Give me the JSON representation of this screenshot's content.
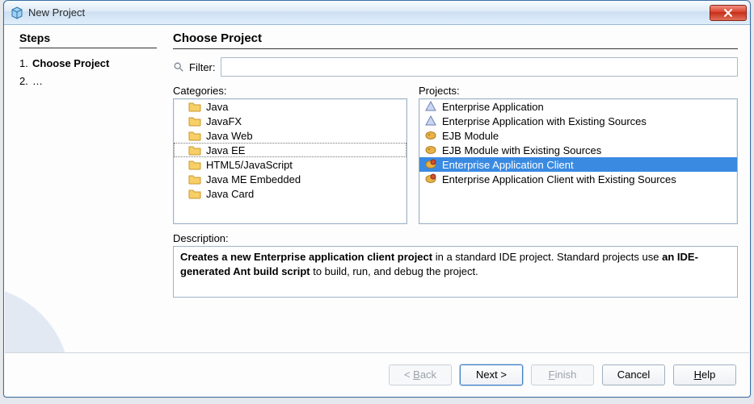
{
  "window": {
    "title": "New Project"
  },
  "steps": {
    "heading": "Steps",
    "items": [
      {
        "num": "1.",
        "label": "Choose Project",
        "current": true
      },
      {
        "num": "2.",
        "label": "…",
        "current": false
      }
    ]
  },
  "main": {
    "heading": "Choose Project",
    "filter_label": "Filter:",
    "filter_value": "",
    "categories_label": "Categories:",
    "projects_label": "Projects:",
    "description_label": "Description:"
  },
  "categories": [
    {
      "label": "Java",
      "icon": "folder",
      "selected": false
    },
    {
      "label": "JavaFX",
      "icon": "folder",
      "selected": false
    },
    {
      "label": "Java Web",
      "icon": "folder",
      "selected": false
    },
    {
      "label": "Java EE",
      "icon": "folder",
      "selected": true
    },
    {
      "label": "HTML5/JavaScript",
      "icon": "folder",
      "selected": false
    },
    {
      "label": "Java ME Embedded",
      "icon": "folder",
      "selected": false
    },
    {
      "label": "Java Card",
      "icon": "folder",
      "selected": false
    }
  ],
  "projects": [
    {
      "label": "Enterprise Application",
      "icon": "triangle",
      "selected": false
    },
    {
      "label": "Enterprise Application with Existing Sources",
      "icon": "triangle",
      "selected": false
    },
    {
      "label": "EJB Module",
      "icon": "bean",
      "selected": false
    },
    {
      "label": "EJB Module with Existing Sources",
      "icon": "bean",
      "selected": false
    },
    {
      "label": "Enterprise Application Client",
      "icon": "ear",
      "selected": true
    },
    {
      "label": "Enterprise Application Client with Existing Sources",
      "icon": "ear",
      "selected": false
    }
  ],
  "description": {
    "html_parts": [
      {
        "t": "Creates a new Enterprise application client project",
        "b": true
      },
      {
        "t": " in a standard IDE project. Standard projects use ",
        "b": false
      },
      {
        "t": "an IDE-generated Ant build script",
        "b": true
      },
      {
        "t": " to build, run, and debug the project.",
        "b": false
      }
    ]
  },
  "buttons": {
    "back": "< Back",
    "next": "Next >",
    "finish": "Finish",
    "cancel": "Cancel",
    "help": "Help"
  }
}
